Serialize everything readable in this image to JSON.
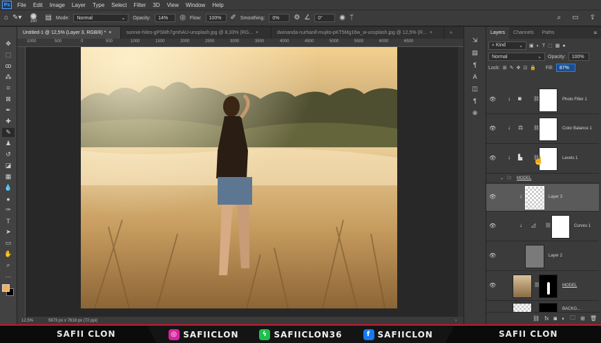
{
  "menu": [
    "File",
    "Edit",
    "Image",
    "Layer",
    "Type",
    "Select",
    "Filter",
    "3D",
    "View",
    "Window",
    "Help"
  ],
  "options": {
    "brush_size": "150",
    "mode_label": "Mode:",
    "mode_value": "Normal",
    "opacity_label": "Opacity:",
    "opacity_value": "14%",
    "flow_label": "Flow:",
    "flow_value": "100%",
    "smoothing_label": "Smoothing:",
    "smoothing_value": "0%",
    "angle_value": "0°"
  },
  "tabs": [
    "Untitled-1 @ 12,5% (Layer 3, RGB/8) *",
    "sonnie-hiles-gPSMh7gmhAU-unsplash.jpg @ 8,33% (RG...",
    "dwinanda-nurhanif-mujito-pKT5Mg16w_w-unsplash.jpg @ 12,5% (R..."
  ],
  "ruler_ticks": [
    "1000",
    "500",
    "0",
    "500",
    "1000",
    "1500",
    "2000",
    "2500",
    "3000",
    "3500",
    "4000",
    "4500",
    "5000",
    "5500",
    "6000",
    "6500"
  ],
  "status": {
    "zoom": "12,5%",
    "doc_size": "5673 px x 7618 px (72 ppi)"
  },
  "panel": {
    "tabs": [
      "Layers",
      "Channels",
      "Paths"
    ],
    "filter_kind": "Kind",
    "blend_mode": "Normal",
    "opacity_label": "Opacity:",
    "opacity_value": "100%",
    "lock_label": "Lock:",
    "fill_label": "Fill:",
    "fill_value": "87%",
    "layers": [
      {
        "name": "Photo Filter 1"
      },
      {
        "name": "Color Balance 1"
      },
      {
        "name": "Levels 1"
      },
      {
        "name": "MODEL"
      },
      {
        "name": "Layer 3"
      },
      {
        "name": "Curves 1"
      },
      {
        "name": "Layer 2"
      },
      {
        "name": "MODEL"
      },
      {
        "name": "BACKG..."
      }
    ]
  },
  "banner": {
    "left": "SAFII CLON",
    "instagram": "SAFIICLON",
    "other": "SAFIICLON36",
    "facebook": "SAFIICLON",
    "right": "SAFII CLON"
  },
  "colors": {
    "accent_red": "#d6112b",
    "instagram": "#d6249f",
    "facebook": "#1877f2",
    "green": "#1fbf4c"
  }
}
